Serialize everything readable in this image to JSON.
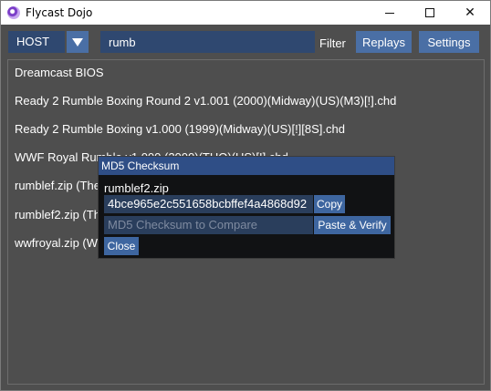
{
  "window": {
    "title": "Flycast Dojo",
    "controls": {
      "minimize": "minimize",
      "maximize": "maximize",
      "close": "✕"
    }
  },
  "toolbar": {
    "mode_value": "HOST",
    "filter_value": "rumb",
    "filter_label": "Filter",
    "replays_label": "Replays",
    "settings_label": "Settings"
  },
  "games": [
    "Dreamcast BIOS",
    "Ready 2 Rumble Boxing Round 2 v1.001 (2000)(Midway)(US)(M3)[!].chd",
    "Ready 2 Rumble Boxing v1.000 (1999)(Midway)(US)[!][8S].chd",
    "WWF Royal Rumble v1.000 (2000)(THQ)(US)[!].chd",
    "rumblef.zip (The Rumble Fish)",
    "rumblef2.zip (The Rumble Fish 2)",
    "wwfroyal.zip (WWF Royal Rumble)"
  ],
  "modal": {
    "title": "MD5 Checksum",
    "filename": "rumblef2.zip",
    "md5": "4bce965e2c551658bcbffef4a4868d92",
    "copy_label": "Copy",
    "compare_placeholder": "MD5 Checksum to Compare",
    "paste_verify_label": "Paste & Verify",
    "close_label": "Close"
  },
  "colors": {
    "background": "#4e4e4e",
    "input_bg": "#2f4870",
    "button_bg": "#4a6fa5",
    "modal_header": "#2f4e86"
  }
}
